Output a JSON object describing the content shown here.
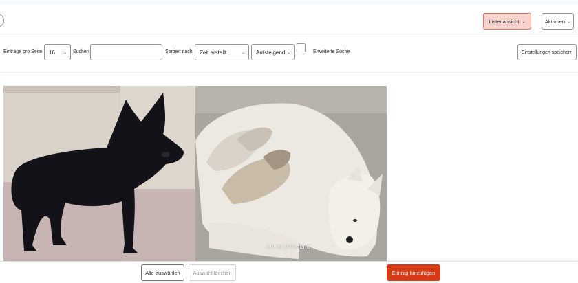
{
  "toolbar": {
    "view_label": "Listenansicht",
    "actions_label": "Aktionen"
  },
  "controls": {
    "per_page_label": "Einträge pro Seite",
    "per_page_value": "16",
    "search_label": "Suchen",
    "search_value": "",
    "sort_by_label": "Sortiert nach",
    "sort_field_value": "Zeit erstellt",
    "sort_order_value": "Aufsteigend",
    "advanced_search_label": "Erweiterte Suche",
    "save_settings_label": "Einstellungen speichern"
  },
  "entries": [
    {
      "caption": ""
    },
    {
      "caption": "Hund schlafend"
    }
  ],
  "footer": {
    "select_all_label": "Alle auswählen",
    "clear_selection_label": "Auswahl löschen",
    "add_entry_label": "Eintrag hinzufügen"
  },
  "colors": {
    "primary": "#d73a17",
    "view_button_bg": "#f6d4cd"
  }
}
